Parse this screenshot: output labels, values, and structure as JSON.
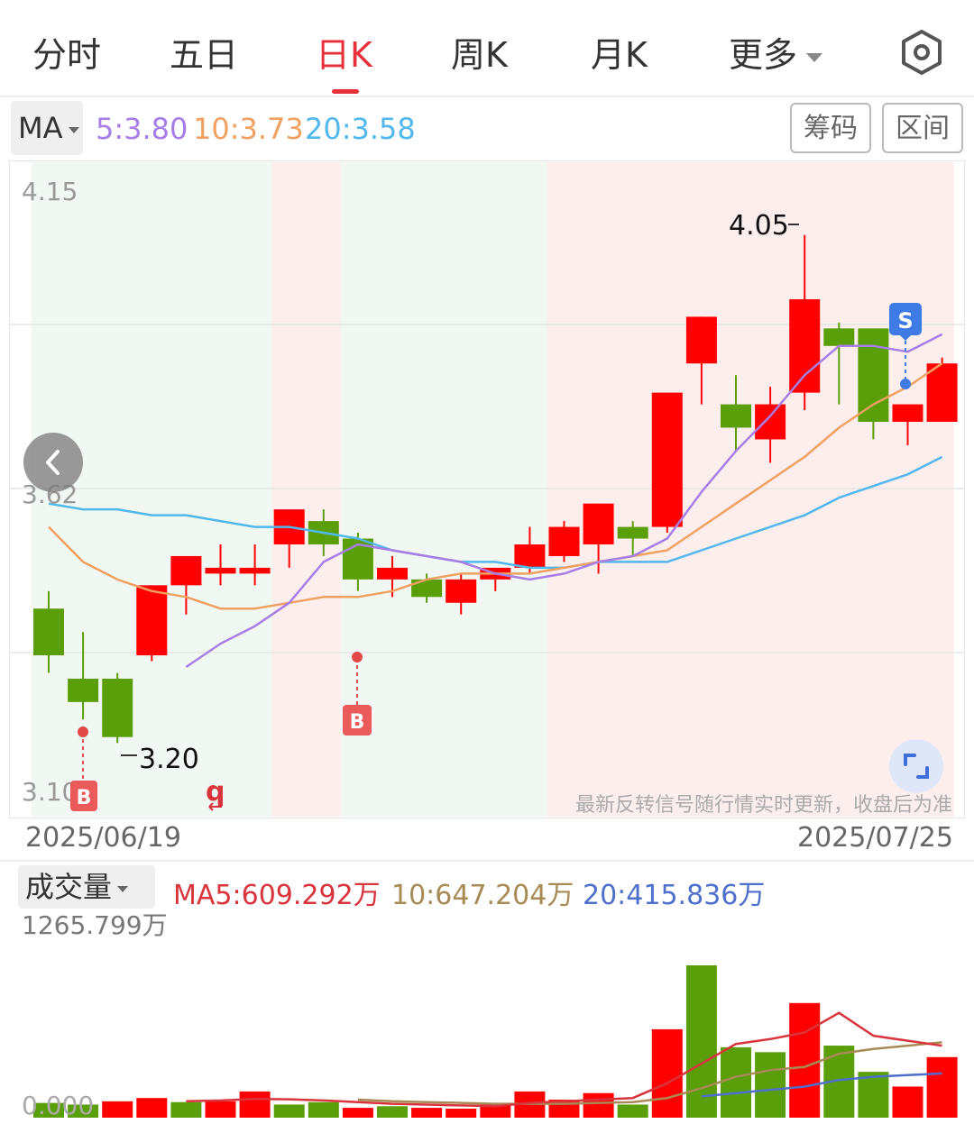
{
  "tabs": [
    {
      "label": "分时",
      "active": false
    },
    {
      "label": "五日",
      "active": false
    },
    {
      "label": "日K",
      "active": true
    },
    {
      "label": "周K",
      "active": false
    },
    {
      "label": "月K",
      "active": false
    },
    {
      "label": "更多",
      "active": false
    }
  ],
  "settings_icon": "settings-hexagon-icon",
  "ma": {
    "selector": "MA",
    "ma5": "5:3.80",
    "ma10": "10:3.73",
    "ma20": "20:3.58",
    "colors": {
      "ma5": "#a77ee6",
      "ma10": "#f0a060",
      "ma20": "#50b8ec"
    }
  },
  "buttons": {
    "chips": "筹码",
    "range": "区间"
  },
  "price_axis": {
    "top": "4.15",
    "mid": "3.62",
    "bottom": "3.10"
  },
  "annotations": {
    "high": "4.05",
    "low": "3.20",
    "notice": "最新反转信号随行情实时更新，收盘后为准"
  },
  "signals": [
    {
      "label": "B",
      "kind": "buy"
    },
    {
      "label": "B",
      "kind": "buy"
    },
    {
      "label": "S",
      "kind": "sell"
    }
  ],
  "dates": {
    "start": "2025/06/19",
    "end": "2025/07/25"
  },
  "volume": {
    "selector": "成交量",
    "ma5": "MA5:609.292万",
    "ma10": "10:647.204万",
    "ma20": "20:415.836万",
    "max": "1265.799万",
    "min": "0.000"
  },
  "chart_data": [
    {
      "type": "candlestick",
      "ylim": [
        3.1,
        4.15
      ],
      "up_color": "#ff0000",
      "down_color": "#5a9e0a",
      "candles": [
        {
          "o": 3.41,
          "h": 3.44,
          "l": 3.3,
          "c": 3.33
        },
        {
          "o": 3.29,
          "h": 3.37,
          "l": 3.22,
          "c": 3.25
        },
        {
          "o": 3.29,
          "h": 3.3,
          "l": 3.18,
          "c": 3.19
        },
        {
          "o": 3.33,
          "h": 3.45,
          "l": 3.32,
          "c": 3.45
        },
        {
          "o": 3.45,
          "h": 3.5,
          "l": 3.4,
          "c": 3.5
        },
        {
          "o": 3.47,
          "h": 3.52,
          "l": 3.45,
          "c": 3.48
        },
        {
          "o": 3.47,
          "h": 3.52,
          "l": 3.45,
          "c": 3.48
        },
        {
          "o": 3.52,
          "h": 3.57,
          "l": 3.48,
          "c": 3.58
        },
        {
          "o": 3.56,
          "h": 3.58,
          "l": 3.5,
          "c": 3.52
        },
        {
          "o": 3.53,
          "h": 3.54,
          "l": 3.44,
          "c": 3.46
        },
        {
          "o": 3.46,
          "h": 3.5,
          "l": 3.43,
          "c": 3.48
        },
        {
          "o": 3.46,
          "h": 3.47,
          "l": 3.42,
          "c": 3.43
        },
        {
          "o": 3.42,
          "h": 3.47,
          "l": 3.4,
          "c": 3.46
        },
        {
          "o": 3.46,
          "h": 3.48,
          "l": 3.44,
          "c": 3.48
        },
        {
          "o": 3.48,
          "h": 3.55,
          "l": 3.47,
          "c": 3.52
        },
        {
          "o": 3.5,
          "h": 3.56,
          "l": 3.49,
          "c": 3.55
        },
        {
          "o": 3.52,
          "h": 3.59,
          "l": 3.47,
          "c": 3.59
        },
        {
          "o": 3.55,
          "h": 3.56,
          "l": 3.5,
          "c": 3.53
        },
        {
          "o": 3.55,
          "h": 3.78,
          "l": 3.54,
          "c": 3.78
        },
        {
          "o": 3.83,
          "h": 3.91,
          "l": 3.76,
          "c": 3.91
        },
        {
          "o": 3.76,
          "h": 3.81,
          "l": 3.68,
          "c": 3.72
        },
        {
          "o": 3.7,
          "h": 3.79,
          "l": 3.66,
          "c": 3.76
        },
        {
          "o": 3.78,
          "h": 4.05,
          "l": 3.75,
          "c": 3.94
        },
        {
          "o": 3.89,
          "h": 3.9,
          "l": 3.76,
          "c": 3.86
        },
        {
          "o": 3.89,
          "h": 3.88,
          "l": 3.7,
          "c": 3.73
        },
        {
          "o": 3.73,
          "h": 3.75,
          "l": 3.69,
          "c": 3.76
        },
        {
          "o": 3.73,
          "h": 3.84,
          "l": 3.73,
          "c": 3.83
        }
      ],
      "ma5": [
        null,
        null,
        null,
        null,
        3.31,
        3.35,
        3.38,
        3.42,
        3.49,
        3.52,
        3.51,
        3.5,
        3.49,
        3.47,
        3.46,
        3.47,
        3.49,
        3.5,
        3.53,
        3.61,
        3.68,
        3.74,
        3.81,
        3.86,
        3.86,
        3.85,
        3.88
      ],
      "ma10": [
        3.55,
        3.49,
        3.46,
        3.44,
        3.43,
        3.41,
        3.41,
        3.42,
        3.43,
        3.43,
        3.44,
        3.46,
        3.47,
        3.47,
        3.47,
        3.48,
        3.49,
        3.5,
        3.51,
        3.55,
        3.59,
        3.63,
        3.67,
        3.72,
        3.76,
        3.79,
        3.83
      ],
      "ma20": [
        3.59,
        3.58,
        3.58,
        3.57,
        3.57,
        3.56,
        3.55,
        3.55,
        3.54,
        3.53,
        3.51,
        3.5,
        3.49,
        3.49,
        3.48,
        3.48,
        3.49,
        3.49,
        3.49,
        3.51,
        3.53,
        3.55,
        3.57,
        3.6,
        3.62,
        3.64,
        3.67
      ],
      "highlight_bands": [
        {
          "from": 0,
          "to": 6,
          "kind": "green"
        },
        {
          "from": 7,
          "to": 8,
          "kind": "red"
        },
        {
          "from": 9,
          "to": 14,
          "kind": "green"
        },
        {
          "from": 15,
          "to": 26,
          "kind": "red"
        }
      ]
    },
    {
      "type": "bar",
      "ylim": [
        0,
        1265.799
      ],
      "unit": "万",
      "values": [
        90,
        80,
        100,
        120,
        95,
        100,
        160,
        80,
        95,
        60,
        70,
        60,
        55,
        80,
        160,
        110,
        150,
        80,
        540,
        930,
        430,
        400,
        700,
        440,
        280,
        190,
        370
      ],
      "up": [
        false,
        false,
        true,
        true,
        false,
        true,
        true,
        false,
        false,
        true,
        false,
        true,
        true,
        true,
        true,
        true,
        true,
        false,
        true,
        false,
        false,
        false,
        true,
        false,
        false,
        true,
        true
      ],
      "ma5": [
        null,
        null,
        null,
        null,
        100,
        105,
        115,
        112,
        105,
        95,
        85,
        80,
        75,
        70,
        90,
        100,
        110,
        120,
        210,
        330,
        450,
        480,
        520,
        640,
        500,
        470,
        440
      ],
      "ma10": [
        null,
        null,
        null,
        null,
        null,
        null,
        null,
        null,
        null,
        110,
        100,
        95,
        90,
        85,
        85,
        85,
        90,
        95,
        120,
        180,
        250,
        290,
        310,
        390,
        420,
        440,
        460
      ],
      "ma20": [
        null,
        null,
        null,
        null,
        null,
        null,
        null,
        null,
        null,
        null,
        null,
        null,
        null,
        null,
        null,
        null,
        null,
        null,
        null,
        130,
        150,
        170,
        190,
        230,
        250,
        260,
        270
      ]
    }
  ]
}
